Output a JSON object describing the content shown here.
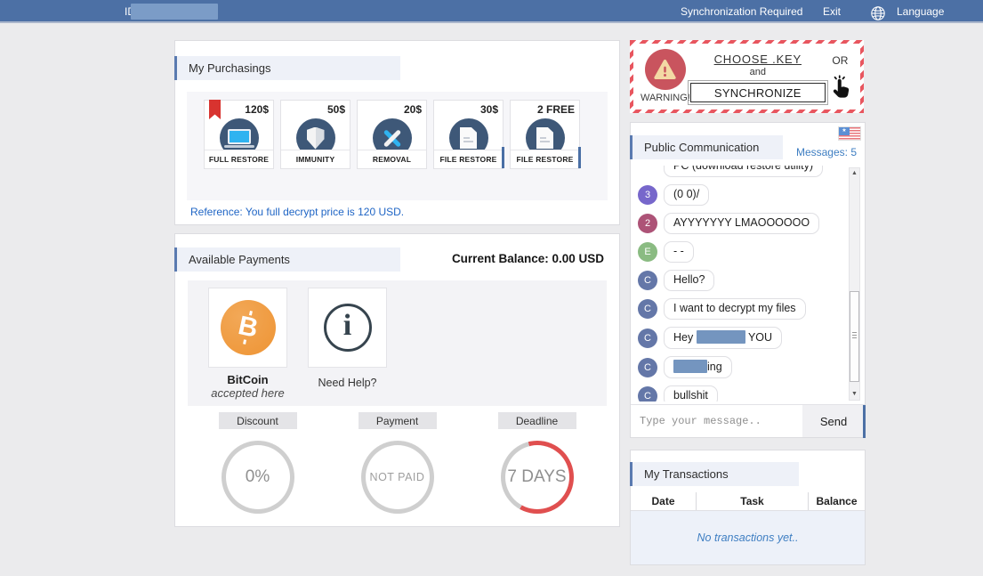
{
  "colors": {
    "topbar_blue": "#4c70a5",
    "accent_blue": "#5a7ab0",
    "link_blue": "#1f65c5",
    "deadline_red": "#e04f4f",
    "bitcoin_orange": "#ee9434",
    "warning_red": "#c9545e",
    "redaction_blue": "#7495bf"
  },
  "topbar": {
    "id_label": "ID:",
    "sync_label": "Synchronization Required",
    "exit_label": "Exit",
    "language_label": "Language"
  },
  "purchasings": {
    "title": "My Purchasings",
    "reference": "Reference: You full decrypt price is 120 USD.",
    "items": [
      {
        "price": "120$",
        "label": "FULL RESTORE",
        "icon": "laptop-icon",
        "bookmarked": true,
        "accent": false
      },
      {
        "price": "50$",
        "label": "IMMUNITY",
        "icon": "shield-icon",
        "bookmarked": false,
        "accent": false
      },
      {
        "price": "20$",
        "label": "REMOVAL",
        "icon": "tools-icon",
        "bookmarked": false,
        "accent": false
      },
      {
        "price": "30$",
        "label": "FILE RESTORE",
        "icon": "file-icon",
        "bookmarked": false,
        "accent": true
      },
      {
        "price": "2 FREE",
        "label": "FILE RESTORE",
        "icon": "file-icon",
        "bookmarked": false,
        "accent": true
      }
    ]
  },
  "payments": {
    "title": "Available Payments",
    "balance": "Current Balance: 0.00 USD",
    "bitcoin_name": "BitCoin",
    "bitcoin_subtitle": "accepted here",
    "help_label": "Need Help?",
    "stats": [
      {
        "label": "Discount",
        "value": "0%",
        "style": "gray"
      },
      {
        "label": "Payment",
        "value": "NOT PAID",
        "style": "gray"
      },
      {
        "label": "Deadline",
        "value": "7 DAYS",
        "style": "red"
      }
    ]
  },
  "warning_box": {
    "warning_label": "WARNING!",
    "choose_key_label": "CHOOSE .KEY",
    "and_label": "and",
    "synchronize_label": "SYNCHRONIZE",
    "or_label": "OR"
  },
  "chat": {
    "title": "Public Communication",
    "messages_counter": "Messages: 5",
    "input_placeholder": "Type your message..",
    "send_label": "Send",
    "messages": [
      {
        "clipped": true,
        "avatar": "",
        "avatar_color": "",
        "parts": [
          {
            "text": "PC (download restore utility)"
          }
        ]
      },
      {
        "avatar": "3",
        "avatar_color": "#7767cb",
        "parts": [
          {
            "text": "(0 0)/"
          }
        ]
      },
      {
        "avatar": "2",
        "avatar_color": "#ad5377",
        "parts": [
          {
            "text": "AYYYYYYY LMAOOOOOO"
          }
        ]
      },
      {
        "avatar": "E",
        "avatar_color": "#8abb82",
        "parts": [
          {
            "text": "- -"
          }
        ]
      },
      {
        "avatar": "C",
        "avatar_color": "#6477a8",
        "parts": [
          {
            "text": "Hello?"
          }
        ]
      },
      {
        "avatar": "C",
        "avatar_color": "#6477a8",
        "parts": [
          {
            "text": "I want to decrypt my files"
          }
        ]
      },
      {
        "avatar": "C",
        "avatar_color": "#6477a8",
        "parts": [
          {
            "text": "Hey "
          },
          {
            "redact_width": 55
          },
          {
            "text": " YOU"
          }
        ]
      },
      {
        "avatar": "C",
        "avatar_color": "#6477a8",
        "parts": [
          {
            "redact_width": 38
          },
          {
            "text": "ing"
          }
        ]
      },
      {
        "avatar": "C",
        "avatar_color": "#6477a8",
        "parts": [
          {
            "text": "bullshit"
          }
        ]
      }
    ]
  },
  "transactions": {
    "title": "My Transactions",
    "columns": [
      "Date",
      "Task",
      "Balance"
    ],
    "empty_text": "No transactions yet.."
  }
}
